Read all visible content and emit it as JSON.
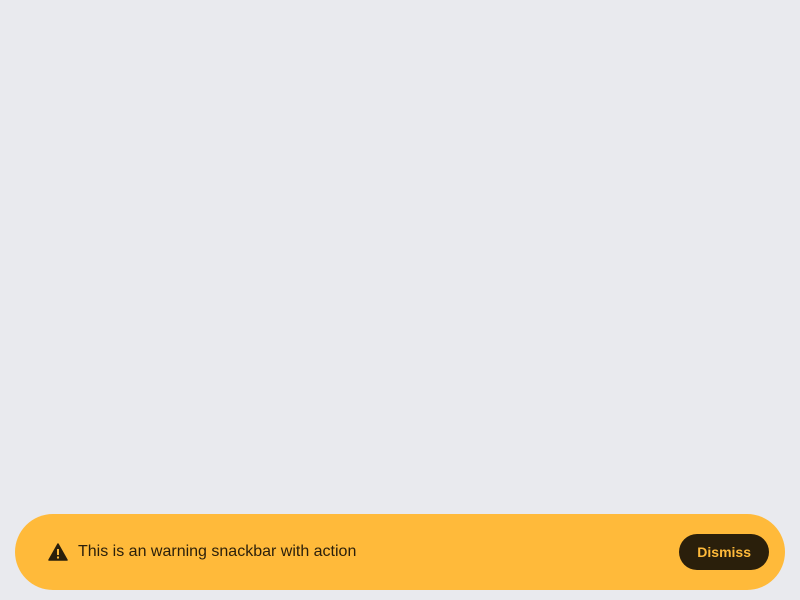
{
  "snackbar": {
    "message": "This is an warning snackbar with action",
    "action_label": "Dismiss",
    "icon": "warning-icon"
  },
  "colors": {
    "background": "#E9EAEE",
    "snackbar": "#FFBA3A",
    "text": "#2A1F0B",
    "action_bg": "#2A1F0B",
    "action_text": "#FFBA3A"
  }
}
